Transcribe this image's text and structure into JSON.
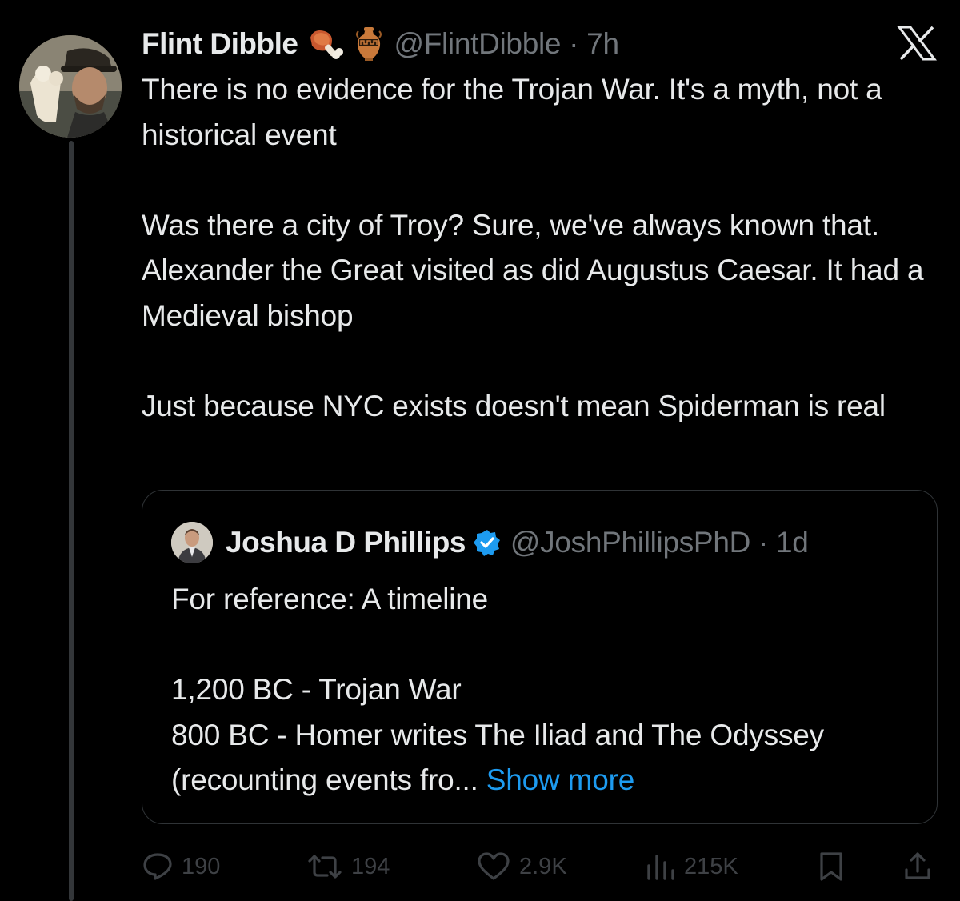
{
  "tweet": {
    "author_name": "Flint Dibble",
    "author_emojis": [
      "meat-on-bone-icon",
      "amphora-icon"
    ],
    "handle_time": "@FlintDibble · 7h",
    "paragraphs": [
      "There is no evidence for the Trojan War. It's a myth, not a historical event",
      "Was there a city of Troy? Sure, we've always known that. Alexander the Great visited as did Augustus Caesar. It had a Medieval bishop",
      "Just because NYC exists doesn't mean Spiderman is real"
    ]
  },
  "quote": {
    "author_name": "Joshua D Phillips",
    "verified": true,
    "handle_time": "@JoshPhillipsPhD · 1d",
    "line1": "For reference: A timeline",
    "line2": "1,200 BC - Trojan War",
    "line3": "800 BC - Homer writes The Iliad and The Odyssey (recounting events fro...",
    "show_more": "Show more"
  },
  "actions": {
    "replies": "190",
    "reposts": "194",
    "likes": "2.9K",
    "views": "215K"
  },
  "colors": {
    "background": "#000000",
    "text": "#e7e9ea",
    "secondary": "#71767b",
    "link": "#1d9bf0",
    "verified": "#1d9bf0"
  }
}
